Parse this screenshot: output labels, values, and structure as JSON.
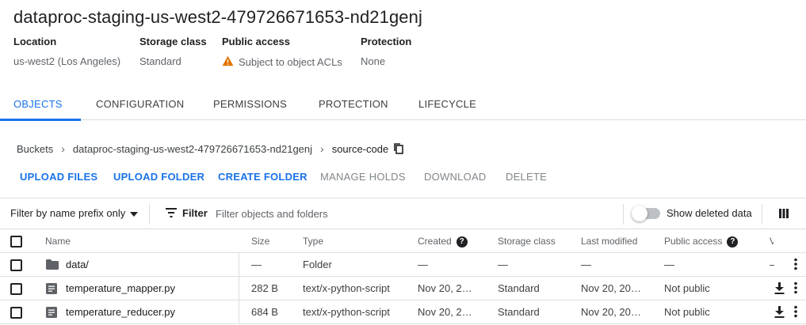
{
  "bucket": {
    "title": "dataproc-staging-us-west2-479726671653-nd21genj"
  },
  "info": [
    {
      "label": "Location",
      "value": "us-west2 (Los Angeles)"
    },
    {
      "label": "Storage class",
      "value": "Standard"
    },
    {
      "label": "Public access",
      "value": "Subject to object ACLs",
      "icon": "warning-icon"
    },
    {
      "label": "Protection",
      "value": "None"
    }
  ],
  "tabs": [
    "OBJECTS",
    "CONFIGURATION",
    "PERMISSIONS",
    "PROTECTION",
    "LIFECYCLE"
  ],
  "breadcrumb": {
    "root": "Buckets",
    "bucket": "dataproc-staging-us-west2-479726671653-nd21genj",
    "current": "source-code"
  },
  "actions": {
    "upload_files": "UPLOAD FILES",
    "upload_folder": "UPLOAD FOLDER",
    "create_folder": "CREATE FOLDER",
    "manage_holds": "MANAGE HOLDS",
    "download": "DOWNLOAD",
    "delete": "DELETE"
  },
  "filter": {
    "prefix_mode": "Filter by name prefix only",
    "label": "Filter",
    "placeholder": "Filter objects and folders",
    "show_deleted": "Show deleted data"
  },
  "table": {
    "headers": {
      "name": "Name",
      "size": "Size",
      "type": "Type",
      "created": "Created",
      "storage_class": "Storage class",
      "last_modified": "Last modified",
      "public_access": "Public access",
      "truncated": "V"
    },
    "rows": [
      {
        "name": "data/",
        "size": "—",
        "type": "Folder",
        "created": "—",
        "storage_class": "—",
        "last_modified": "—",
        "public_access": "—",
        "extra": "–",
        "icon": "folder-icon"
      },
      {
        "name": "temperature_mapper.py",
        "size": "282 B",
        "type": "text/x-python-script",
        "created": "Nov 20, 2…",
        "storage_class": "Standard",
        "last_modified": "Nov 20, 20…",
        "public_access": "Not public",
        "icon": "file-icon"
      },
      {
        "name": "temperature_reducer.py",
        "size": "684 B",
        "type": "text/x-python-script",
        "created": "Nov 20, 2…",
        "storage_class": "Standard",
        "last_modified": "Nov 20, 20…",
        "public_access": "Not public",
        "icon": "file-icon"
      }
    ]
  },
  "colors": {
    "accent": "#1a73e8",
    "warning": "#e37400",
    "text": "#202124",
    "muted": "#5f6368",
    "disabled": "#80868b"
  }
}
